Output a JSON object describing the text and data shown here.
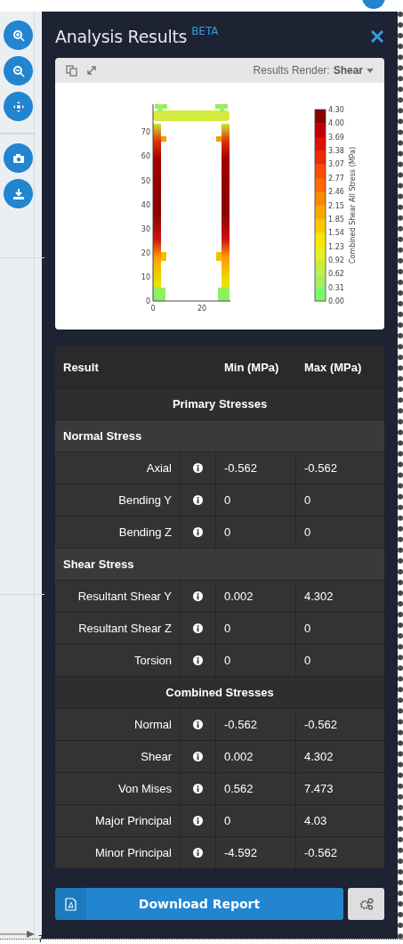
{
  "panel": {
    "title": "Analysis Results",
    "badge": "BETA"
  },
  "plot_toolbar": {
    "render_label": "Results Render:",
    "render_value": "Shear"
  },
  "plot": {
    "y_ticks": [
      "70",
      "60",
      "50",
      "40",
      "30",
      "20",
      "10",
      "0"
    ],
    "x_ticks": [
      "0",
      "20"
    ],
    "colorbar_ticks": [
      "4.30",
      "4.00",
      "3.69",
      "3.38",
      "3.07",
      "2.77",
      "2.46",
      "2.15",
      "1.85",
      "1.54",
      "1.23",
      "0.92",
      "0.62",
      "0.31",
      "0.00"
    ],
    "colorbar_label": "Combined Shear All Stress (MPa)"
  },
  "table": {
    "columns": [
      "Result",
      "Min (MPa)",
      "Max (MPa)"
    ],
    "rows": [
      {
        "kind": "section",
        "label": "Primary Stresses"
      },
      {
        "kind": "group",
        "label": "Normal Stress"
      },
      {
        "kind": "value",
        "label": "Axial",
        "min": "-0.562",
        "max": "-0.562"
      },
      {
        "kind": "value",
        "label": "Bending Y",
        "min": "0",
        "max": "0"
      },
      {
        "kind": "value",
        "label": "Bending Z",
        "min": "0",
        "max": "0"
      },
      {
        "kind": "group",
        "label": "Shear Stress"
      },
      {
        "kind": "value",
        "label": "Resultant Shear Y",
        "min": "0.002",
        "max": "4.302"
      },
      {
        "kind": "value",
        "label": "Resultant Shear Z",
        "min": "0",
        "max": "0"
      },
      {
        "kind": "value",
        "label": "Torsion",
        "min": "0",
        "max": "0"
      },
      {
        "kind": "section",
        "label": "Combined Stresses"
      },
      {
        "kind": "value",
        "label": "Normal",
        "min": "-0.562",
        "max": "-0.562"
      },
      {
        "kind": "value",
        "label": "Shear",
        "min": "0.002",
        "max": "4.302"
      },
      {
        "kind": "value",
        "label": "Von Mises",
        "min": "0.562",
        "max": "7.473"
      },
      {
        "kind": "value",
        "label": "Major Principal",
        "min": "0",
        "max": "4.03"
      },
      {
        "kind": "value",
        "label": "Minor Principal",
        "min": "-4.592",
        "max": "-0.562"
      }
    ]
  },
  "download_button": "Download Report",
  "canvas_axis": {
    "tick": "7"
  }
}
